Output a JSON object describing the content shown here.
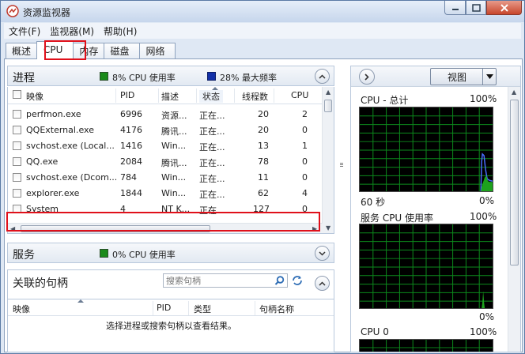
{
  "window": {
    "title": "资源监视器"
  },
  "menu": [
    "文件(F)",
    "监视器(M)",
    "帮助(H)"
  ],
  "tabs": [
    "概述",
    "CPU",
    "内存",
    "磁盘",
    "网络"
  ],
  "process_section": {
    "title": "进程",
    "cpu_usage": "8% CPU 使用率",
    "max_freq": "28% 最大频率",
    "columns": [
      "映像",
      "PID",
      "描述",
      "状态",
      "线程数",
      "CPU"
    ],
    "rows": [
      {
        "image": "perfmon.exe",
        "pid": "6996",
        "desc": "资源...",
        "status": "正在...",
        "threads": "20",
        "cpu": "2"
      },
      {
        "image": "QQExternal.exe",
        "pid": "4176",
        "desc": "腾讯...",
        "status": "正在...",
        "threads": "20",
        "cpu": "0"
      },
      {
        "image": "svchost.exe (Local...",
        "pid": "1416",
        "desc": "Win...",
        "status": "正在...",
        "threads": "13",
        "cpu": "1"
      },
      {
        "image": "QQ.exe",
        "pid": "2084",
        "desc": "腾讯...",
        "status": "正在...",
        "threads": "78",
        "cpu": "0"
      },
      {
        "image": "svchost.exe (Dcom...",
        "pid": "784",
        "desc": "Win...",
        "status": "正在...",
        "threads": "11",
        "cpu": "0"
      },
      {
        "image": "explorer.exe",
        "pid": "1844",
        "desc": "Win...",
        "status": "正在...",
        "threads": "62",
        "cpu": "4"
      },
      {
        "image": "System",
        "pid": "4",
        "desc": "NT K...",
        "status": "正在...",
        "threads": "127",
        "cpu": "0"
      }
    ]
  },
  "services_section": {
    "title": "服务",
    "cpu_usage": "0% CPU 使用率"
  },
  "handles_section": {
    "title": "关联的句柄",
    "search_placeholder": "搜索句柄",
    "columns": [
      "映像",
      "PID",
      "类型",
      "句柄名称"
    ],
    "empty_message": "选择进程或搜索句柄以查看结果。"
  },
  "right_panel": {
    "view_label": "视图",
    "graphs": [
      {
        "title": "CPU - 总计",
        "max": "100%",
        "time_label": "60 秒",
        "min": "0%"
      },
      {
        "title": "服务 CPU 使用率",
        "max": "100%",
        "min": "0%"
      },
      {
        "title": "CPU 0",
        "max": "100%"
      }
    ]
  },
  "colors": {
    "accent_green": "#1a8a1a",
    "accent_blue": "#1230a8",
    "highlight_red": "#e0101a",
    "graph_grid": "#0c8a1c"
  }
}
